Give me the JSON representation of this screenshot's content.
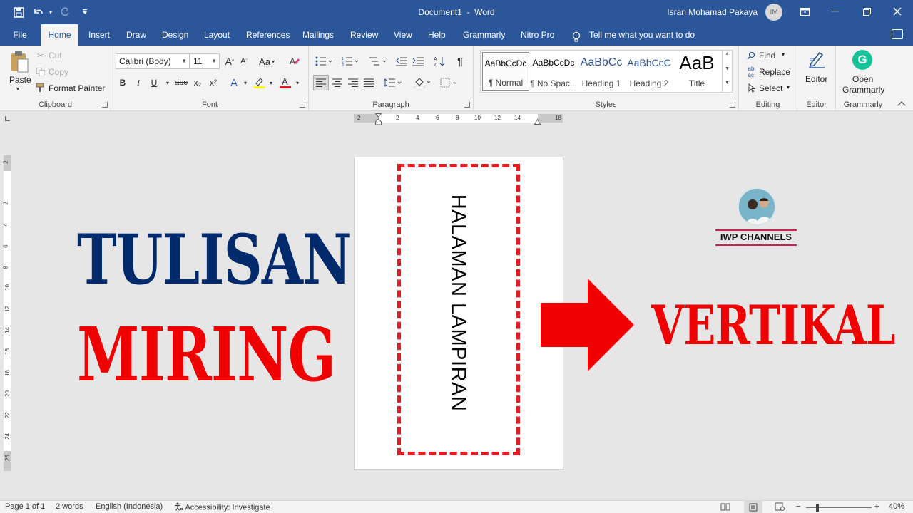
{
  "titlebar": {
    "document": "Document1",
    "separator": "-",
    "app": "Word",
    "user": "Isran Mohamad Pakaya",
    "avatar_initials": "IM",
    "icons": [
      "save-icon",
      "undo-icon",
      "redo-icon",
      "customize-quick-access-icon",
      "ribbon-display-icon",
      "minimize-icon",
      "restore-icon",
      "close-icon"
    ]
  },
  "menu": {
    "tabs": [
      "File",
      "Home",
      "Insert",
      "Draw",
      "Design",
      "Layout",
      "References",
      "Mailings",
      "Review",
      "View",
      "Help",
      "Grammarly",
      "Nitro Pro"
    ],
    "active": "Home",
    "tell_me": "Tell me what you want to do"
  },
  "clipboard": {
    "paste": "Paste",
    "cut": "Cut",
    "copy": "Copy",
    "format_painter": "Format Painter",
    "label": "Clipboard"
  },
  "font": {
    "name": "Calibri (Body)",
    "size": "11",
    "label": "Font",
    "case_label": "Aa",
    "buttons": [
      "B",
      "I",
      "U",
      "abc",
      "x₂",
      "x²"
    ]
  },
  "paragraph": {
    "label": "Paragraph"
  },
  "styles": {
    "label": "Styles",
    "items": [
      {
        "sample": "AaBbCcDc",
        "name": "¶ Normal"
      },
      {
        "sample": "AaBbCcDc",
        "name": "¶ No Spac..."
      },
      {
        "sample": "AaBbCc",
        "name": "Heading 1"
      },
      {
        "sample": "AaBbCcC",
        "name": "Heading 2"
      },
      {
        "sample": "AaB",
        "name": "Title"
      }
    ]
  },
  "editing": {
    "find": "Find",
    "replace": "Replace",
    "select": "Select",
    "label": "Editing"
  },
  "editor": {
    "button": "Editor",
    "label": "Editor"
  },
  "grammarly": {
    "button_line1": "Open",
    "button_line2": "Grammarly",
    "label": "Grammarly"
  },
  "hruler_labels": [
    "2",
    "2",
    "4",
    "6",
    "8",
    "10",
    "12",
    "14",
    "18"
  ],
  "vruler_labels": [
    "2",
    "2",
    "4",
    "6",
    "8",
    "10",
    "12",
    "14",
    "16",
    "18",
    "20",
    "22",
    "24",
    "26"
  ],
  "document": {
    "textbox_text": "HALAMAN LAMPIRAN"
  },
  "overlay": {
    "line1": "TULISAN",
    "line2": "MIRING",
    "line3": "VERTIKAL",
    "logo_text": "IWP CHANNELS",
    "colors": {
      "navy": "#002a6b",
      "red": "#f00000"
    }
  },
  "status": {
    "page": "Page 1 of 1",
    "words": "2 words",
    "language": "English (Indonesia)",
    "accessibility": "Accessibility: Investigate",
    "zoom_minus": "−",
    "zoom_plus": "+",
    "zoom": "40%"
  },
  "accent_color": "#2b579a"
}
